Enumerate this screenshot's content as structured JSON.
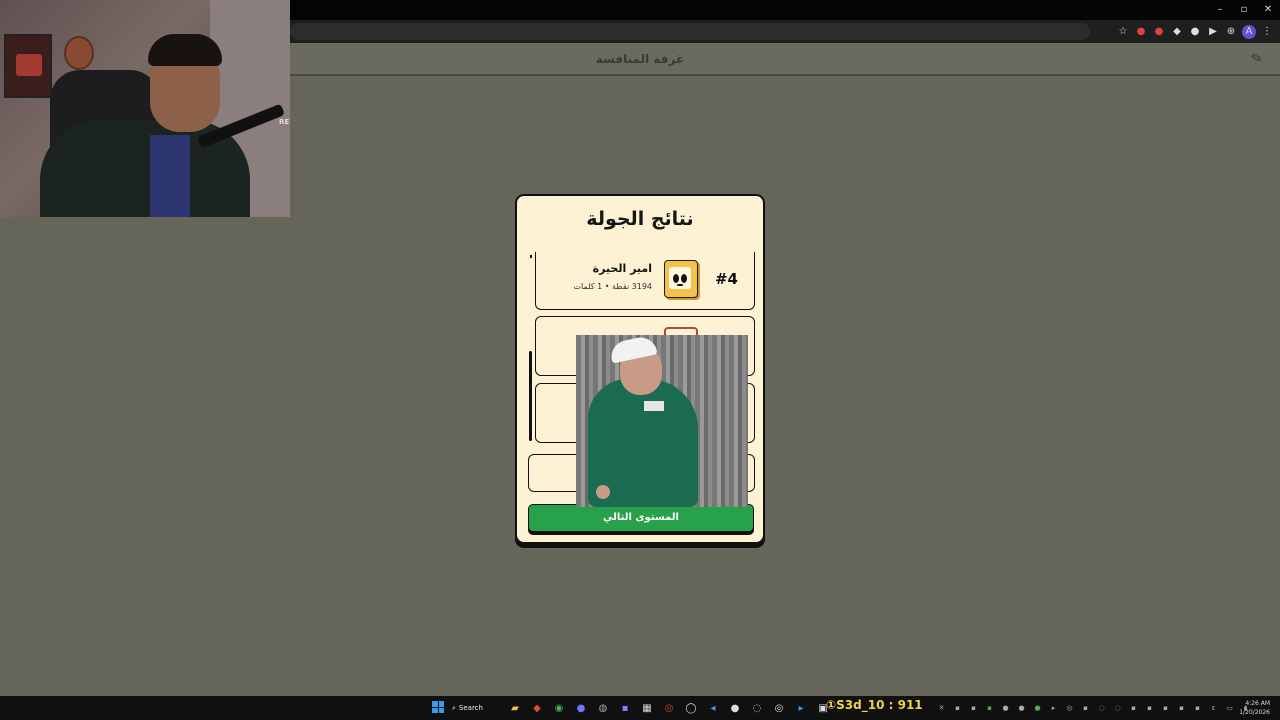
{
  "browser": {
    "window_controls": [
      "–",
      "▫",
      "✕"
    ],
    "extension_icons": [
      "☆",
      "●",
      "●",
      "◆",
      "●",
      "▶",
      "⊕",
      "A",
      "⋮"
    ]
  },
  "page": {
    "header_title": "غرفة المنافسة",
    "logo_text": "✎"
  },
  "webcam": {
    "mic_label": "RE"
  },
  "modal": {
    "title": "نتائج الجولة",
    "players": [
      {
        "rank": "#4",
        "name": "امير الحيرة",
        "stats": "3194 نقطة • 1 كلمات"
      },
      {
        "rank": "",
        "name": "",
        "stats": ""
      },
      {
        "rank": "",
        "name": "",
        "stats": ""
      }
    ],
    "next_button": "المستوى التالي"
  },
  "taskbar": {
    "search_label": "Search",
    "marquee": "①S3d_10 : 911",
    "clock_time": "4:26 AM",
    "clock_date": "1/20/2026"
  }
}
